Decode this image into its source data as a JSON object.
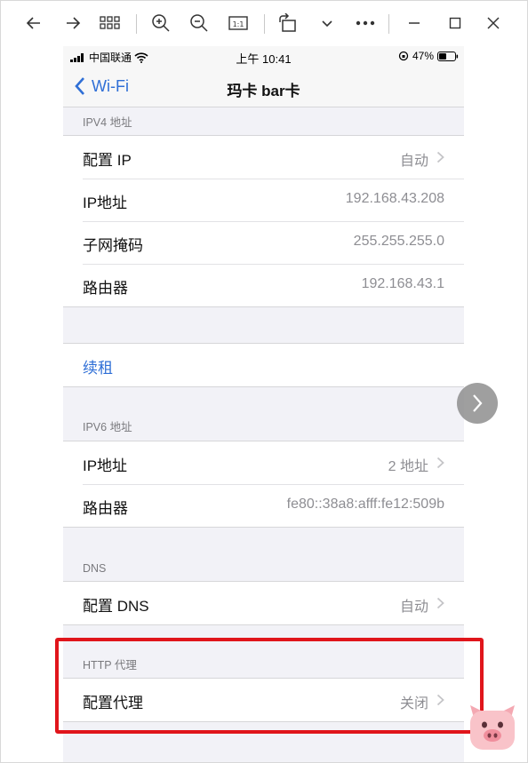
{
  "viewer": {
    "toolbar": [
      "back-arrow",
      "forward-arrow",
      "grid-view",
      "zoom-in",
      "zoom-out",
      "actual-size",
      "rotate",
      "more-dropdown",
      "more-options",
      "minimize",
      "maximize",
      "close"
    ]
  },
  "phone": {
    "status": {
      "carrier": "中国联通",
      "time": "上午 10:41",
      "battery": "47%"
    },
    "nav": {
      "back_label": "Wi-Fi",
      "title": "玛卡 bar卡"
    },
    "ipv4": {
      "header": "IPV4 地址",
      "rows": [
        {
          "label": "配置 IP",
          "value": "自动"
        },
        {
          "label": "IP地址",
          "value": "192.168.43.208"
        },
        {
          "label": "子网掩码",
          "value": "255.255.255.0"
        },
        {
          "label": "路由器",
          "value": "192.168.43.1"
        }
      ]
    },
    "renew": {
      "label": "续租"
    },
    "ipv6": {
      "header": "IPV6 地址",
      "rows": [
        {
          "label": "IP地址",
          "value": "2 地址"
        },
        {
          "label": "路由器",
          "value": "fe80::38a8:afff:fe12:509b"
        }
      ]
    },
    "dns": {
      "header": "DNS",
      "rows": [
        {
          "label": "配置 DNS",
          "value": "自动"
        }
      ]
    },
    "http_proxy": {
      "header": "HTTP 代理",
      "rows": [
        {
          "label": "配置代理",
          "value": "关闭"
        }
      ]
    }
  },
  "colors": {
    "accent": "#2f6fd6",
    "highlight": "#e0151b",
    "secondary_text": "#8e8e93",
    "grouped_bg": "#f2f2f7"
  }
}
